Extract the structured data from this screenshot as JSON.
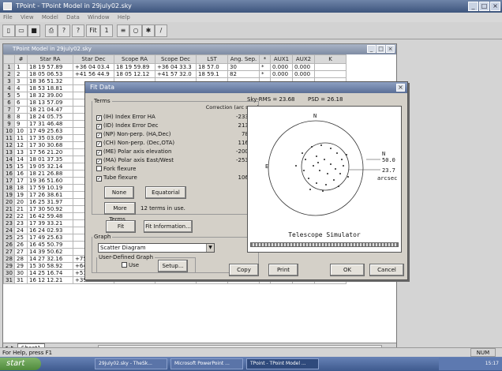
{
  "window": {
    "title": "TPoint - TPoint Model in 29july02.sky"
  },
  "menu": [
    "File",
    "View",
    "Model",
    "Data",
    "Window",
    "Help"
  ],
  "toolbar": {
    "fit_label": "Fit",
    "bar_label": "1"
  },
  "child": {
    "title": "TPoint Model in 29july02.sky"
  },
  "grid": {
    "headers": [
      "#",
      "Star RA",
      "Star Dec",
      "Scope RA",
      "Scope Dec",
      "LST",
      "Ang. Sep.",
      "*",
      "AUX1",
      "AUX2",
      "K"
    ],
    "rows": [
      [
        "1",
        "1",
        "18 19 57.89",
        "+36 04 03.4",
        "18 19 59.89",
        "+36 04 33.3",
        "18 57.0",
        "30",
        "*",
        "0.000",
        "0.000",
        ""
      ],
      [
        "2",
        "2",
        "18 05 06.53",
        "+41 56 44.9",
        "18 05 12.12",
        "+41 57 32.0",
        "18 59.1",
        "82",
        "*",
        "0.000",
        "0.000",
        ""
      ],
      [
        "3",
        "3",
        "18 36 51.32",
        "",
        "",
        "",
        "",
        "",
        "",
        "",
        "",
        ""
      ],
      [
        "4",
        "4",
        "18 53 18.81",
        "",
        "",
        "",
        "",
        "",
        "",
        "",
        "",
        ""
      ],
      [
        "5",
        "5",
        "18 32 39.00",
        "",
        "",
        "",
        "",
        "",
        "",
        "",
        "",
        ""
      ],
      [
        "6",
        "6",
        "18 13 57.09",
        "",
        "",
        "",
        "",
        "",
        "",
        "",
        "",
        ""
      ],
      [
        "7",
        "7",
        "18 21 04.47",
        "",
        "",
        "",
        "",
        "",
        "",
        "",
        "",
        ""
      ],
      [
        "8",
        "8",
        "18 24 05.75",
        "",
        "",
        "",
        "",
        "",
        "",
        "",
        "",
        ""
      ],
      [
        "9",
        "9",
        "17 31 46.48",
        "",
        "",
        "",
        "",
        "",
        "",
        "",
        "",
        ""
      ],
      [
        "10",
        "10",
        "17 49 25.63",
        "",
        "",
        "",
        "",
        "",
        "",
        "",
        "",
        ""
      ],
      [
        "11",
        "11",
        "17 35 03.09",
        "",
        "",
        "",
        "",
        "",
        "",
        "",
        "",
        ""
      ],
      [
        "12",
        "12",
        "17 30 30.68",
        "",
        "",
        "",
        "",
        "",
        "",
        "",
        "",
        ""
      ],
      [
        "13",
        "13",
        "17 56 21.20",
        "",
        "",
        "",
        "",
        "",
        "",
        "",
        "",
        ""
      ],
      [
        "14",
        "14",
        "18 01 37.35",
        "",
        "",
        "",
        "",
        "",
        "",
        "",
        "",
        ""
      ],
      [
        "15",
        "15",
        "19 05 32.14",
        "",
        "",
        "",
        "",
        "",
        "",
        "",
        "",
        ""
      ],
      [
        "16",
        "16",
        "18 21 26.88",
        "",
        "",
        "",
        "",
        "",
        "",
        "",
        "",
        ""
      ],
      [
        "17",
        "17",
        "19 36 51.60",
        "",
        "",
        "",
        "",
        "",
        "",
        "",
        "",
        ""
      ],
      [
        "18",
        "18",
        "17 59 10.19",
        "",
        "",
        "",
        "",
        "",
        "",
        "",
        "",
        ""
      ],
      [
        "19",
        "19",
        "17 26 38.61",
        "",
        "",
        "",
        "",
        "",
        "",
        "",
        "",
        ""
      ],
      [
        "20",
        "20",
        "16 25 31.97",
        "",
        "",
        "",
        "",
        "",
        "",
        "",
        "",
        ""
      ],
      [
        "21",
        "21",
        "17 30 50.92",
        "",
        "",
        "",
        "",
        "",
        "",
        "",
        "",
        ""
      ],
      [
        "22",
        "22",
        "16 42 59.48",
        "",
        "",
        "",
        "",
        "",
        "",
        "",
        "",
        ""
      ],
      [
        "23",
        "23",
        "17 39 33.21",
        "",
        "",
        "",
        "",
        "",
        "",
        "",
        "",
        ""
      ],
      [
        "24",
        "24",
        "16 24 02.93",
        "",
        "",
        "",
        "",
        "",
        "",
        "",
        "",
        ""
      ],
      [
        "25",
        "25",
        "17 49 25.63",
        "",
        "",
        "",
        "",
        "",
        "",
        "",
        "",
        ""
      ],
      [
        "26",
        "26",
        "16 45 50.79",
        "",
        "",
        "",
        "",
        "",
        "",
        "",
        "",
        ""
      ],
      [
        "27",
        "27",
        "14 39 50.62",
        "",
        "",
        "",
        "",
        "",
        "",
        "",
        "",
        ""
      ],
      [
        "28",
        "28",
        "14 27 32.16",
        "+75 41 28.0",
        "14 28 18.28",
        "+75 41 32.4",
        "20 37.9",
        "171",
        "*",
        "0.000",
        "0.000",
        ""
      ],
      [
        "29",
        "29",
        "15 30 58.92",
        "+64 12 20.7",
        "15 31 26.82",
        "+64 13 21.4",
        "20 39.7",
        "184",
        "*",
        "0.000",
        "0.000",
        ""
      ],
      [
        "30",
        "30",
        "14 25 16.74",
        "+51 50 43.0",
        "14 25 25.76",
        "+51 51 53.3",
        "20 41.6",
        "109",
        "*",
        "0.000",
        "0.000",
        ""
      ],
      [
        "31",
        "31",
        "16 12 12.21",
        "+39 03 11.7",
        "16 12 19.21",
        "+39 04 56.3",
        "20 43.6",
        "132",
        "*",
        "0.000",
        "0.000",
        ""
      ]
    ]
  },
  "sheet_tab": "Sheet1",
  "dialog": {
    "title": "Fit Data",
    "terms_legend": "Terms",
    "correction_header": "Correction (arc secs)",
    "terms": [
      {
        "label": "(IH) Index Error HA",
        "checked": "✓",
        "value": "-233.58"
      },
      {
        "label": "(ID) Index Error Dec",
        "checked": "✓",
        "value": "213.46"
      },
      {
        "label": "(NP) Non-perp. (HA,Dec)",
        "checked": "✓",
        "value": "78.30"
      },
      {
        "label": "(CH) Non-perp. (Dec,OTA)",
        "checked": "✓",
        "value": "116.98"
      },
      {
        "label": "(ME) Polar axis elevation",
        "checked": "✓",
        "value": "-200.09"
      },
      {
        "label": "(MA) Polar axis East/West",
        "checked": "✓",
        "value": "-253.83"
      },
      {
        "label": "Fork flexure",
        "checked": "",
        "value": ""
      },
      {
        "label": "Tube flexure",
        "checked": "✓",
        "value": "106.79"
      }
    ],
    "none_btn": "None",
    "equatorial_btn": "Equatorial",
    "more_terms_btn": "More Terms...",
    "terms_in_use": "12 terms in use.",
    "fit_btn": "Fit",
    "fit_info_btn": "Fit Information...",
    "graph_legend": "Graph",
    "graph_select": "Scatter Diagram",
    "user_graph_legend": "User-Defined Graph",
    "use_label": "Use",
    "setup_btn": "Setup...",
    "copy_btn": "Copy",
    "print_btn": "Print",
    "ok_btn": "OK",
    "cancel_btn": "Cancel",
    "sky_rms": "Sky-RMS = 23.68",
    "psd": "PSD = 26.18",
    "plot": {
      "north": "N",
      "east": "E",
      "scale_n": "N",
      "scale_1": "50.0",
      "scale_2": "23.7",
      "scale_unit": "arcsec",
      "footer": "Telescope Simulator"
    }
  },
  "status": "For Help, press F1",
  "status_num": "NUM",
  "taskbar": {
    "start": "start",
    "tasks": [
      "29july02.sky - TheSk...",
      "Microsoft PowerPoint ...",
      "TPoint - TPoint Model ..."
    ],
    "clock": "15:17"
  }
}
